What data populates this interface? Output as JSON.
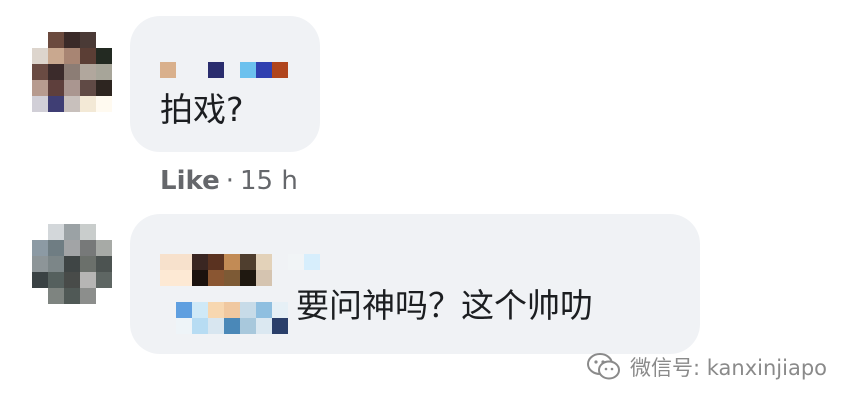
{
  "comments": [
    {
      "text": "拍戏?",
      "like_label": "Like",
      "separator": "·",
      "time": "15 h"
    },
    {
      "text": "要问神吗？这个帅叻"
    }
  ],
  "watermark": {
    "icon": "wechat-icon",
    "text": "微信号: kanxinjiapo"
  },
  "colors": {
    "bubble_bg": "#f0f2f5",
    "text": "#1c1e21",
    "meta_text": "#65676b",
    "watermark_text": "#8a8a8a"
  }
}
